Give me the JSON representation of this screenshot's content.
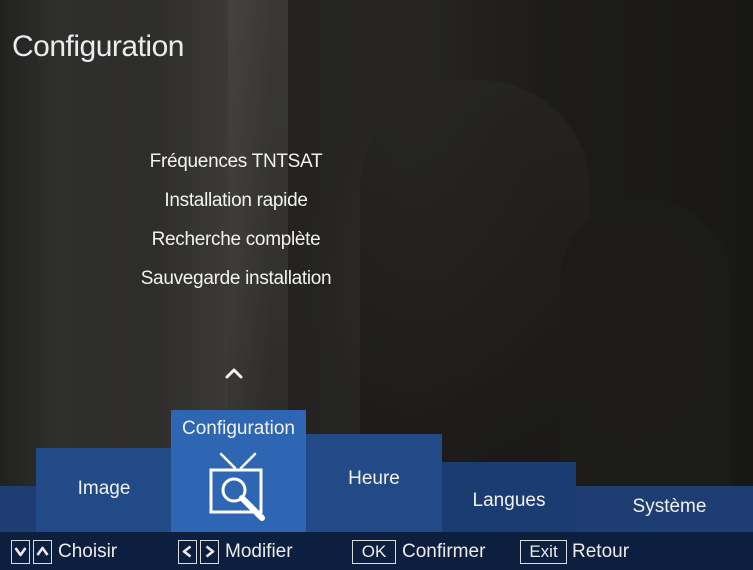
{
  "screen_title": "Configuration",
  "submenu": [
    "Fréquences TNTSAT",
    "Installation rapide",
    "Recherche complète",
    "Sauvegarde installation"
  ],
  "tabs": {
    "image": "Image",
    "configuration": "Configuration",
    "heure": "Heure",
    "langues": "Langues",
    "systeme": "Système"
  },
  "selected_tab": "Configuration",
  "help": {
    "choose_label": "Choisir",
    "modify_label": "Modifier",
    "ok_key": "OK",
    "confirm_label": "Confirmer",
    "exit_key": "Exit",
    "back_label": "Retour"
  },
  "colors": {
    "tab_selected": "#2f66b4",
    "tab_normal": "#224a86",
    "tab_strip": "#1e3d72",
    "help_bar": "#0d1f3f",
    "text": "#f2f2f2"
  },
  "icons": [
    "tv-search-icon",
    "up-chevron-icon",
    "down-arrow-icon",
    "up-arrow-icon",
    "left-arrow-icon",
    "right-arrow-icon"
  ]
}
